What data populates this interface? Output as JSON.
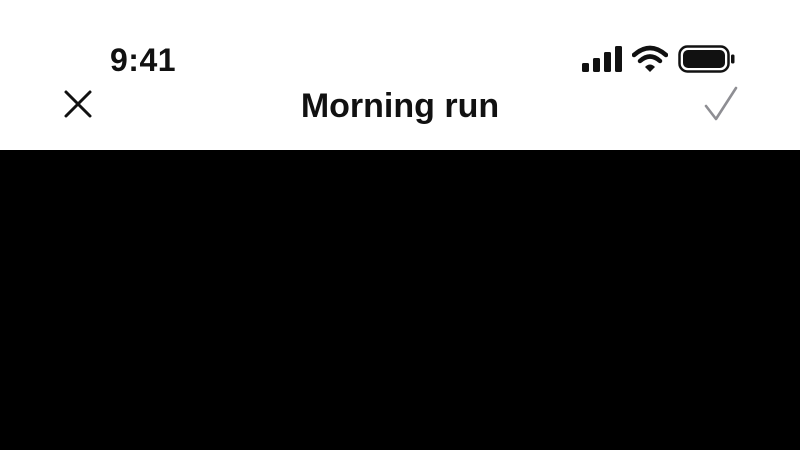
{
  "status_bar": {
    "time": "9:41",
    "icons": [
      "cellular-signal-icon",
      "wifi-icon",
      "battery-icon"
    ]
  },
  "nav": {
    "title": "Morning run",
    "close_icon": "close-icon",
    "confirm_icon": "checkmark-icon"
  },
  "colors": {
    "text": "#111111",
    "confirm_disabled": "#8e8e93",
    "content_background": "#000000",
    "header_background": "#ffffff"
  }
}
